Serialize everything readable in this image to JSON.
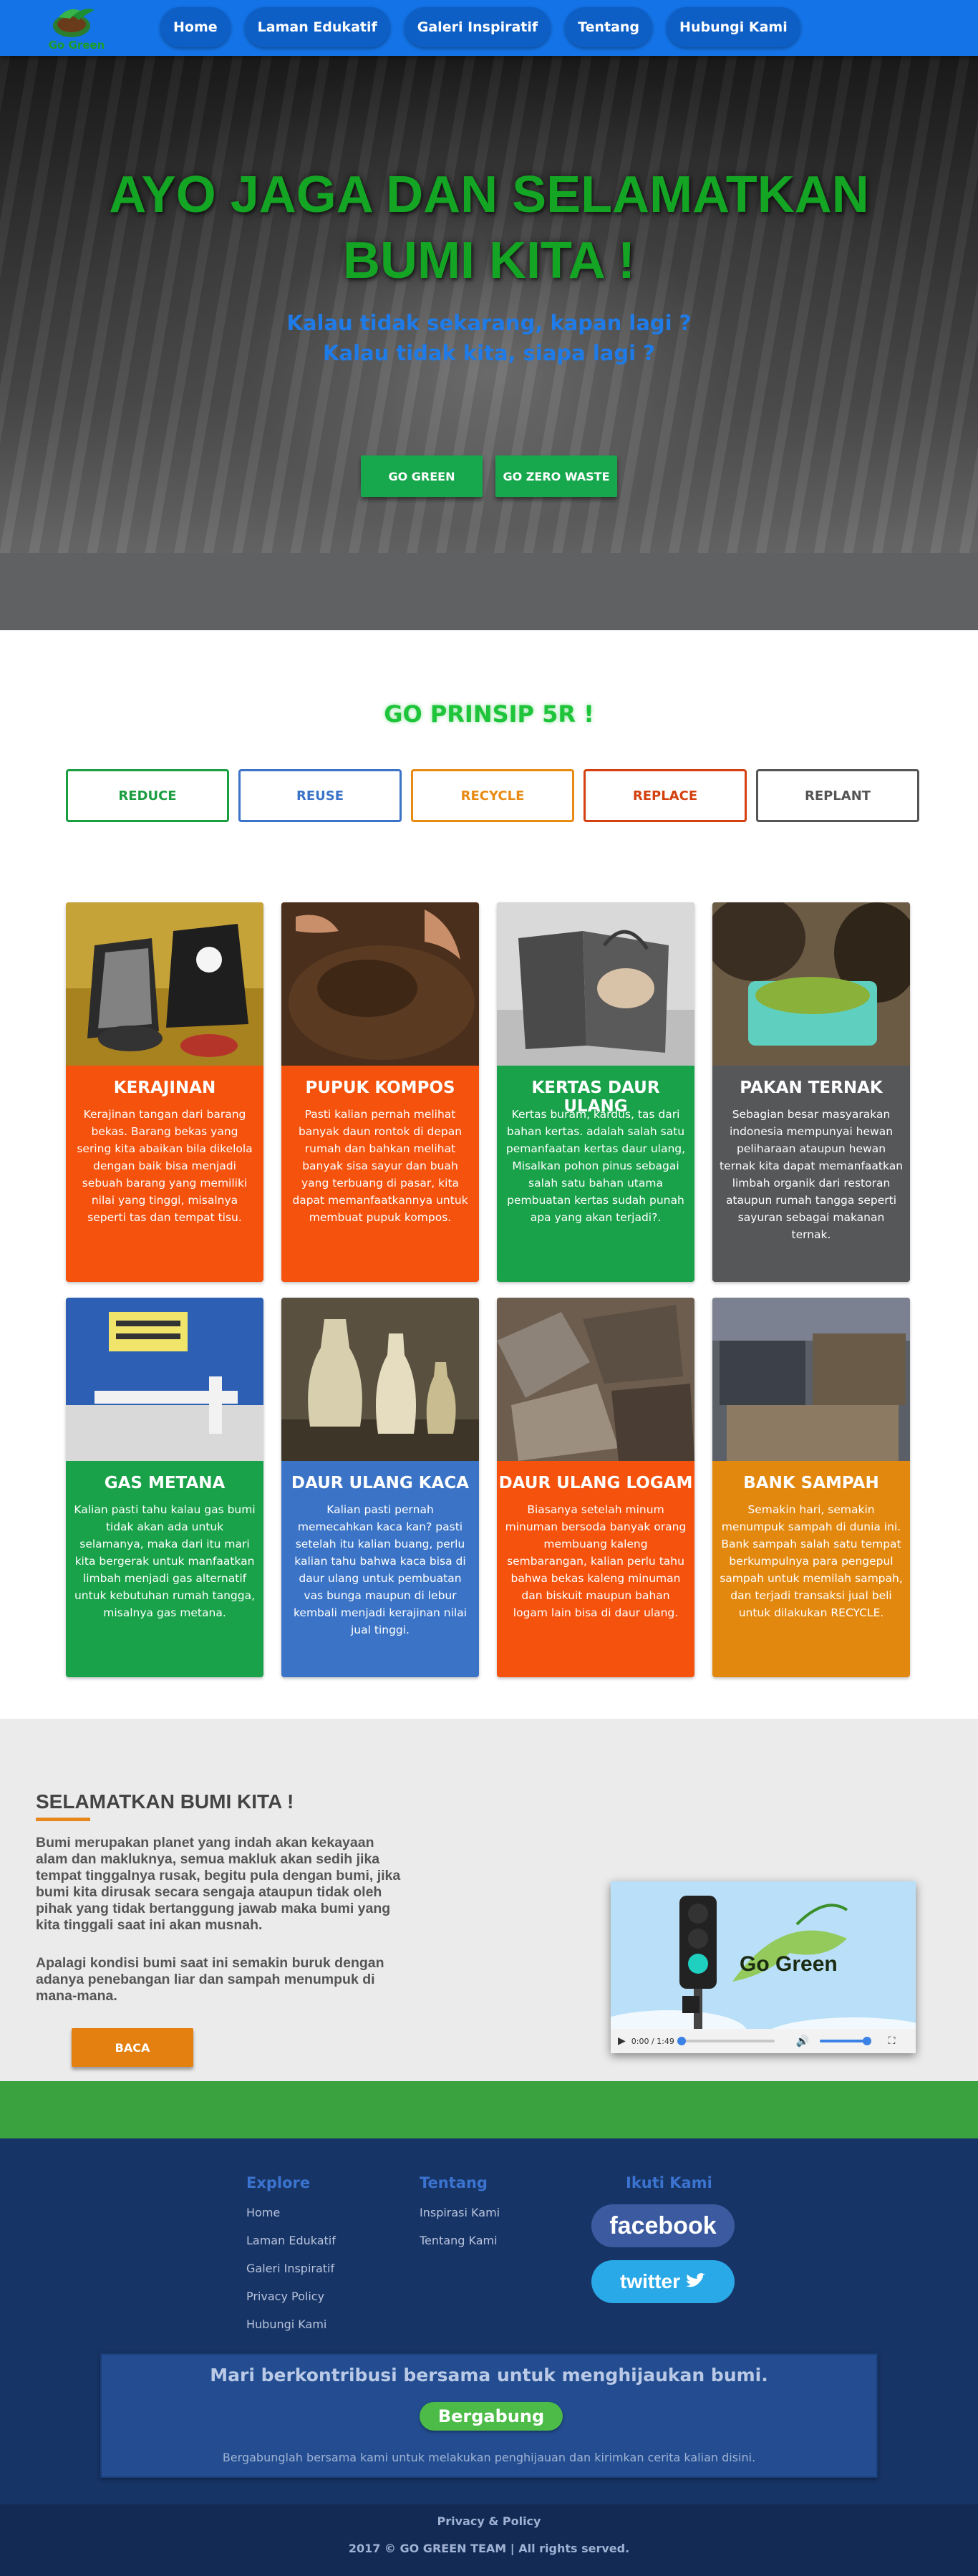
{
  "brand": {
    "logo_text": "Go Green"
  },
  "nav": [
    "Home",
    "Laman Edukatif",
    "Galeri Inspiratif",
    "Tentang",
    "Hubungi Kami"
  ],
  "hero": {
    "title_line1": "AYO JAGA DAN SELAMATKAN",
    "title_line2": "BUMI KITA !",
    "sub_line1": "Kalau tidak sekarang, kapan lagi ?",
    "sub_line2": "Kalau tidak kita, siapa lagi ?",
    "btn_green": "GO GREEN",
    "btn_zero": "GO ZERO WASTE"
  },
  "prinsip": {
    "title": "GO PRINSIP 5R !",
    "tabs": [
      {
        "label": "REDUCE",
        "color": "#1a9e3f"
      },
      {
        "label": "REUSE",
        "color": "#3b73c8"
      },
      {
        "label": "RECYCLE",
        "color": "#e88b12"
      },
      {
        "label": "REPLACE",
        "color": "#d4400f"
      },
      {
        "label": "REPLANT",
        "color": "#555555"
      }
    ]
  },
  "cards": [
    {
      "title": "KERAJINAN",
      "text": "Kerajinan tangan dari barang bekas. Barang bekas yang sering kita abaikan bila dikelola dengan baik bisa menjadi sebuah barang yang memiliki nilai yang tinggi, misalnya seperti tas dan tempat tisu.",
      "color": "#f4520d",
      "image": "handicraft-bags-photo"
    },
    {
      "title": "PUPUK KOMPOS",
      "text": "Pasti kalian pernah melihat banyak daun rontok di depan rumah dan bahkan melihat banyak sisa sayur dan buah yang terbuang di pasar, kita dapat memanfaatkannya untuk membuat pupuk kompos.",
      "color": "#f4520d",
      "image": "compost-soil-photo"
    },
    {
      "title": "KERTAS DAUR ULANG",
      "text": "Kertas buram, kardus, tas dari bahan kertas. adalah salah satu pemanfaatan kertas daur ulang, Misalkan pohon pinus sebagai salah satu bahan utama pembuatan kertas sudah punah apa yang akan terjadi?.",
      "color": "#19a24a",
      "image": "paper-bag-photo"
    },
    {
      "title": "PAKAN TERNAK",
      "text": "Sebagian besar masyarakan indonesia mempunyai hewan peliharaan ataupun hewan ternak kita dapat memanfaatkan limbah organik dari restoran ataupun rumah tangga seperti sayuran sebagai makanan ternak.",
      "color": "#555759",
      "image": "livestock-feed-photo"
    },
    {
      "title": "GAS METANA",
      "text": "Kalian pasti tahu kalau gas bumi tidak akan ada untuk selamanya, maka dari itu mari kita bergerak untuk manfaatkan limbah menjadi gas alternatif untuk kebutuhan rumah tangga, misalnya gas metana.",
      "color": "#19a24a",
      "image": "methane-meter-photo"
    },
    {
      "title": "DAUR ULANG KACA",
      "text": "Kalian pasti pernah memecahkan kaca kan? pasti setelah itu kalian buang, perlu kalian tahu bahwa kaca bisa di daur ulang untuk pembuatan vas bunga maupun di lebur kembali menjadi kerajinan nilai jual tinggi.",
      "color": "#3b74c6",
      "image": "glass-vase-photo"
    },
    {
      "title": "DAUR ULANG LOGAM",
      "text": "Biasanya setelah minum minuman bersoda banyak orang membuang kaleng sembarangan, kalian perlu tahu bahwa bekas kaleng minuman dan biskuit maupun bahan logam lain bisa di daur ulang.",
      "color": "#f4520d",
      "image": "scrap-metal-photo"
    },
    {
      "title": "BANK SAMPAH",
      "text": "Semakin hari, semakin menumpuk sampah di dunia ini. Bank sampah salah satu tempat berkumpulnya para pengepul sampah untuk memilah sampah, dan terjadi transaksi jual beli untuk dilakukan RECYCLE.",
      "color": "#e3880f",
      "image": "waste-bank-photo"
    }
  ],
  "selamat": {
    "title": "SELAMATKAN BUMI KITA !",
    "p1": "Bumi merupakan planet yang indah akan kekayaan alam dan makluknya, semua makluk akan sedih jika tempat tinggalnya rusak, begitu pula dengan bumi, jika bumi kita dirusak secara sengaja ataupun tidak oleh pihak yang tidak bertanggung jawab maka bumi yang kita tinggali saat ini akan musnah.",
    "p2": "Apalagi kondisi bumi saat ini semakin buruk dengan adanya penebangan liar dan sampah menumpuk di mana-mana.",
    "btn": "BACA",
    "video": {
      "brand": "Go Green",
      "time": "0:00 / 1:49",
      "progress": 0.0
    }
  },
  "footer": {
    "explore_title": "Explore",
    "explore": [
      "Home",
      "Laman Edukatif",
      "Galeri Inspiratif",
      "Privacy Policy",
      "Hubungi Kami"
    ],
    "tentang_title": "Tentang",
    "tentang": [
      "Inspirasi Kami",
      "Tentang Kami"
    ],
    "ikuti_title": "Ikuti Kami",
    "facebook": "facebook",
    "twitter": "twitter",
    "contrib_title": "Mari berkontribusi bersama untuk menghijaukan bumi.",
    "contrib_btn": "Bergabung",
    "contrib_text": "Bergabunglah bersama kami untuk melakukan penghijauan dan kirimkan cerita kalian disini.",
    "policy": "Privacy & Policy",
    "copyright": "2017 © GO GREEN TEAM | All rights served."
  }
}
